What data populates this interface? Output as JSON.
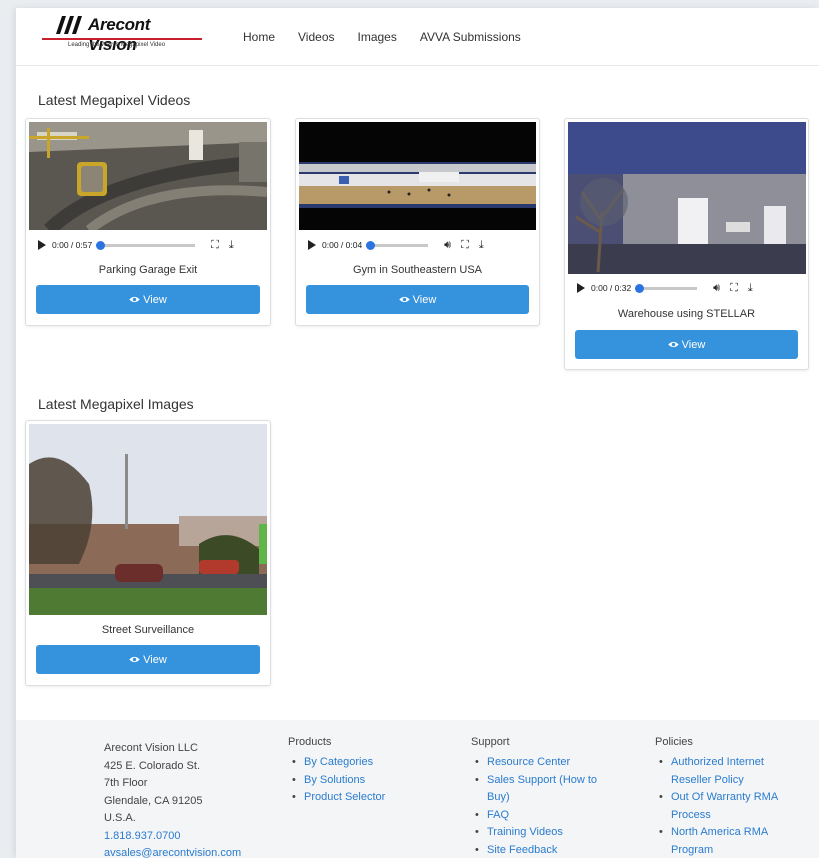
{
  "brand": {
    "name": "Arecont Vision",
    "tagline": "Leading the Way in Megapixel Video"
  },
  "nav": [
    "Home",
    "Videos",
    "Images",
    "AVVA Submissions"
  ],
  "videos_section": {
    "title": "Latest Megapixel Videos",
    "items": [
      {
        "time": "0:00 / 0:57",
        "progress": 0,
        "caption": "Parking Garage Exit",
        "button": "View"
      },
      {
        "time": "0:00 / 0:04",
        "progress": 0,
        "caption": "Gym in Southeastern USA",
        "button": "View"
      },
      {
        "time": "0:00 / 0:32",
        "progress": 0,
        "caption": "Warehouse using STELLAR",
        "button": "View"
      }
    ]
  },
  "images_section": {
    "title": "Latest Megapixel Images",
    "items": [
      {
        "caption": "Street Surveillance",
        "button": "View"
      }
    ]
  },
  "footer": {
    "address": [
      "Arecont Vision LLC",
      "425 E. Colorado St.",
      "7th Floor",
      "Glendale, CA 91205",
      "U.S.A."
    ],
    "phone": "1.818.937.0700",
    "email": "avsales@arecontvision.com",
    "columns": [
      {
        "title": "Products",
        "items": [
          "By Categories",
          "By Solutions",
          "Product Selector"
        ]
      },
      {
        "title": "Support",
        "items": [
          "Resource Center",
          "Sales Support (How to Buy)",
          "FAQ",
          "Training Videos",
          "Site Feedback"
        ]
      },
      {
        "title": "Policies",
        "items": [
          "Authorized Internet Reseller Policy",
          "Out Of Warranty RMA Process",
          "North America RMA Program"
        ]
      }
    ]
  },
  "colors": {
    "accent": "#3592dc",
    "link": "#2a7ccf",
    "brand_red": "#c8202f"
  }
}
